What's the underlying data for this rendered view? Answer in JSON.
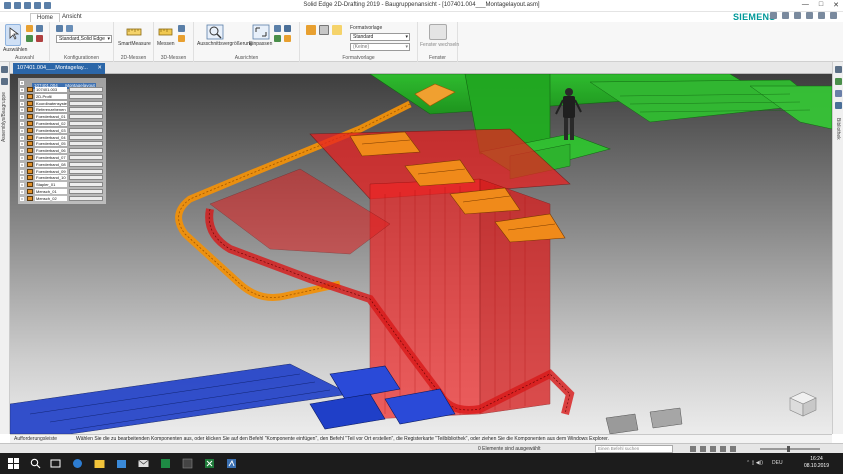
{
  "window": {
    "title": "Solid Edge 2D-Drafting 2019 - Baugruppenansicht - [107401.004___Montagelayout.asm]",
    "controls": [
      "—",
      "□",
      "✕"
    ]
  },
  "ribbon_tabs": [
    {
      "label": "Home",
      "active": true
    },
    {
      "label": "Ansicht",
      "active": false
    }
  ],
  "brand": "SIEMENS",
  "ribbon": {
    "select_button": "Auswählen",
    "group_auswahl": "Auswahl",
    "config_combo_value": "Standard,Solid Edge",
    "group_konfigurationen": "Konfigurationen",
    "smartmeasure_button": "SmartMeasure",
    "group_2d_messen": "2D-Messen",
    "messen_button": "Messen",
    "group_3d_messen": "3D-Messen",
    "ausschnitt_button": "Ausschnittsvergrößerung",
    "einpassen_button": "Einpassen",
    "group_ausrichten": "Ausrichten",
    "formatvorlage_label": "Formatvorlage",
    "format_combo_value": "Standard",
    "format_combo2_value": "(Keine)",
    "group_formatvorlage": "Formatvorlage",
    "fenster_button": "Fenster wechseln",
    "group_fenster": "Fenster"
  },
  "left_panel_label": "Assemblys/Baugruppe",
  "right_panel_label": "Bibliothek",
  "document_tab": {
    "label": "107401.004___Montagelay..."
  },
  "tree": {
    "header": "107401.004___Montagelayout",
    "rows": [
      "107401.003",
      "2D-Profil",
      "Koordinatensystem",
      "Referenzebenen",
      "Foerderband_01",
      "Foerderband_02",
      "Foerderband_03",
      "Foerderband_04",
      "Foerderband_05",
      "Foerderband_06",
      "Foerderband_07",
      "Foerderband_08",
      "Foerderband_09",
      "Foerderband_10",
      "Stapler_01",
      "Mensch_01",
      "Mensch_02"
    ]
  },
  "prompt": {
    "label": "Aufforderungsleiste",
    "message": "Wählen Sie die zu bearbeitenden Komponenten aus, oder klicken Sie auf den Befehl \"Komponente einfügen\", den Befehl \"Teil vor Ort erstellen\", die Registerkarte \"Teilbibliothek\", oder ziehen Sie die Komponenten aus dem Windows Explorer."
  },
  "status": {
    "selection_text": "0 Elemente sind ausgewählt",
    "search_placeholder": "Einen Befehl suchen",
    "zoom_level": 0.47
  },
  "taskbar": {
    "tray_lang": "DEU",
    "time": "16:24",
    "date": "08.10.2019"
  },
  "colors": {
    "accent": "#2b66a8",
    "brand": "#009999",
    "red_conveyor": "#e02020",
    "green_platform": "#22bb22",
    "orange_conveyor": "#f0900a",
    "blue_pallet": "#1f3fc8"
  }
}
